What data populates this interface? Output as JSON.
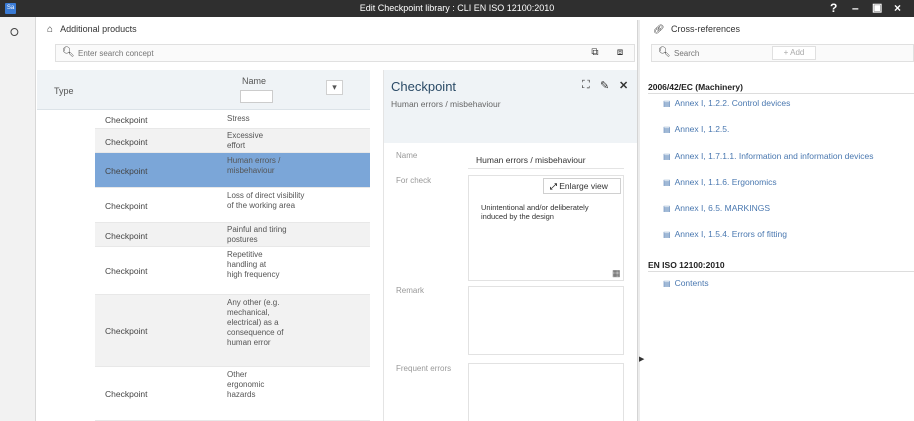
{
  "titlebar": {
    "app_badge": "Sa",
    "title": "Edit Checkpoint library : CLI EN ISO 12100:2010",
    "help": "?",
    "minimize": "–",
    "maximize": "▣",
    "close": "×"
  },
  "products": {
    "header": "Additional products",
    "search_placeholder": "Enter search concept"
  },
  "table": {
    "col_type": "Type",
    "col_name": "Name",
    "filter_icon": "▾",
    "rows": [
      {
        "type": "Checkpoint",
        "name": "Stress"
      },
      {
        "type": "Checkpoint",
        "name": "Excessive effort"
      },
      {
        "type": "Checkpoint",
        "name": "Human errors / misbehaviour"
      },
      {
        "type": "Checkpoint",
        "name": "Loss of direct visibility of the working area"
      },
      {
        "type": "Checkpoint",
        "name": "Painful and tiring postures"
      },
      {
        "type": "Checkpoint",
        "name": "Repetitive handling at high frequency"
      },
      {
        "type": "Checkpoint",
        "name": "Any other (e.g. mechanical, electrical) as a consequence of human error"
      },
      {
        "type": "Checkpoint",
        "name": "Other ergonomic hazards"
      }
    ]
  },
  "detail": {
    "title": "Checkpoint",
    "subtitle": "Human errors / misbehaviour",
    "name_label": "Name",
    "name_value": "Human errors / misbehaviour",
    "forcheck_label": "For check",
    "enlarge_label": "Enlarge view",
    "forcheck_text": "Unintentional and/or deliberately induced by the design",
    "remark_label": "Remark",
    "frequent_label": "Frequent errors"
  },
  "xref": {
    "header": "Cross-references",
    "search_placeholder": "Search",
    "add_label": "+ Add",
    "groups": [
      {
        "title": "2006/42/EC (Machinery)",
        "items": [
          "Annex I, 1.2.2. Control devices",
          "Annex I, 1.2.5.",
          "Annex I, 1.7.1.1. Information and information devices",
          "Annex I, 1.1.6. Ergonomics",
          "Annex I, 6.5. MARKINGS",
          "Annex I, 1.5.4. Errors of fitting"
        ]
      },
      {
        "title": "EN ISO 12100:2010",
        "items": [
          "Contents"
        ]
      }
    ]
  }
}
